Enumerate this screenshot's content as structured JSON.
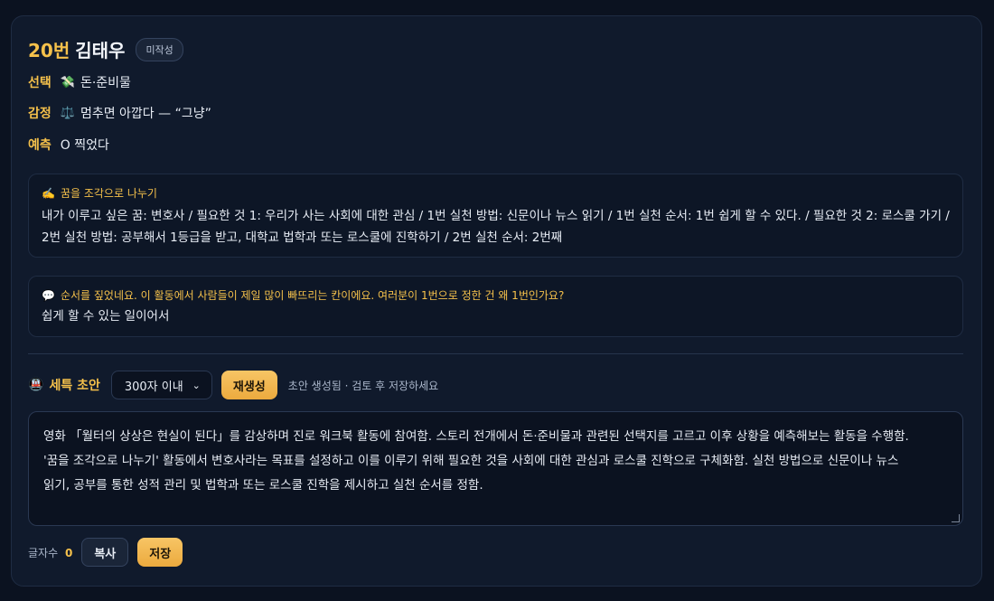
{
  "student": {
    "number": "20번",
    "name": "김태우",
    "status": "미작성"
  },
  "choice": {
    "label": "선택",
    "icon": "💸",
    "value": "돈·준비물"
  },
  "emotion": {
    "label": "감정",
    "icon": "⚖️",
    "value": "멈추면 아깝다 — “그냥”"
  },
  "prediction": {
    "label": "예측",
    "value": "O 찍었다"
  },
  "activity": {
    "icon": "✍️",
    "title": "꿈을 조각으로 나누기",
    "body_line1": "내가 이루고 싶은 꿈: 변호사 / 필요한 것 1: 우리가 사는 사회에 대한 관심 / 1번 실천 방법: 신문이나 뉴스 읽기 / 1번 실천 순서: 1번 쉽게 할 수 있다. / 필요한 것 2: 로스쿨 가기 /",
    "body_line2": "2번 실천 방법: 공부해서 1등급을 받고, 대학교 법학과 또는 로스쿨에 진학하기 / 2번 실천 순서: 2번째"
  },
  "question": {
    "icon": "💬",
    "prompt": "순서를 짚었네요. 이 활동에서 사람들이 제일 많이 빠뜨리는 칸이에요. 여러분이 1번으로 정한 건 왜 1번인가요?",
    "answer": "쉽게 할 수 있는 일이어서"
  },
  "seteuk": {
    "icon": "🚇",
    "label": "세특 초안",
    "length_option": "300자 이내",
    "regenerate_label": "재생성",
    "hint": "초안 생성됨 · 검토 후 저장하세요",
    "draft_line1": "영화 「월터의 상상은 현실이 된다」를 감상하며 진로 워크북 활동에 참여함. 스토리 전개에서 돈·준비물과 관련된 선택지를 고르고 이후 상황을 예측해보는 활동을 수행함.",
    "draft_line2": "'꿈을 조각으로 나누기' 활동에서 변호사라는 목표를 설정하고 이를 이루기 위해 필요한 것을 사회에 대한 관심과 로스쿨 진학으로 구체화함. 실천 방법으로 신문이나 뉴스",
    "draft_line3": "읽기, 공부를 통한 성적 관리 및 법학과 또는 로스쿨 진학을 제시하고 실천 순서를 정함."
  },
  "footer": {
    "count_label": "글자수",
    "count_value": "0",
    "copy_label": "복사",
    "save_label": "저장"
  }
}
